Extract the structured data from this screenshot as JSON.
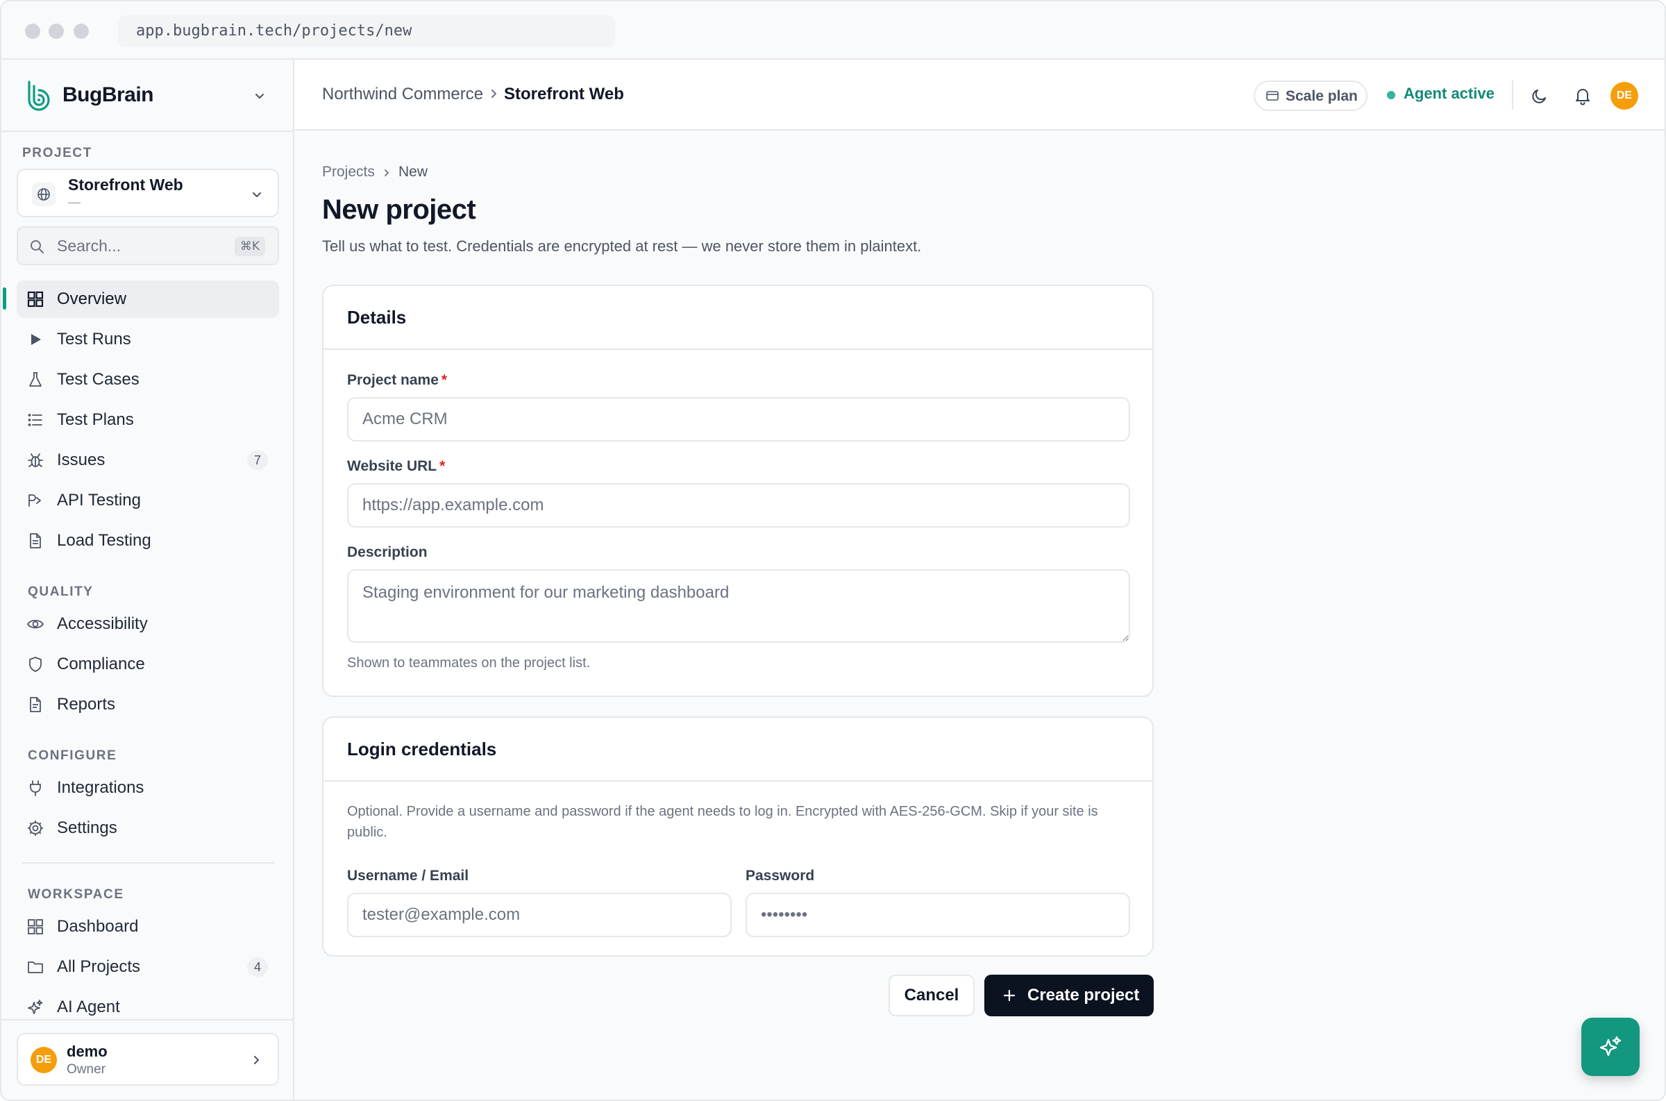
{
  "browser": {
    "url": "app.bugbrain.tech/projects/new"
  },
  "brand": {
    "name": "BugBrain"
  },
  "sidebar": {
    "project_section_label": "PROJECT",
    "project_selector": {
      "name": "Storefront Web",
      "subtitle": "—"
    },
    "search": {
      "placeholder": "Search...",
      "shortcut": "⌘K"
    },
    "main_items": [
      {
        "label": "Overview",
        "icon": "grid-icon",
        "active": true
      },
      {
        "label": "Test Runs",
        "icon": "play-icon"
      },
      {
        "label": "Test Cases",
        "icon": "flask-icon"
      },
      {
        "label": "Test Plans",
        "icon": "list-icon"
      },
      {
        "label": "Issues",
        "icon": "bug-icon",
        "badge": "7"
      },
      {
        "label": "API Testing",
        "icon": "api-icon"
      },
      {
        "label": "Load Testing",
        "icon": "file-icon"
      }
    ],
    "quality_label": "QUALITY",
    "quality_items": [
      {
        "label": "Accessibility",
        "icon": "eye-icon"
      },
      {
        "label": "Compliance",
        "icon": "shield-icon"
      },
      {
        "label": "Reports",
        "icon": "report-icon"
      }
    ],
    "configure_label": "CONFIGURE",
    "configure_items": [
      {
        "label": "Integrations",
        "icon": "plug-icon"
      },
      {
        "label": "Settings",
        "icon": "gear-icon"
      }
    ],
    "workspace_label": "WORKSPACE",
    "workspace_items": [
      {
        "label": "Dashboard",
        "icon": "grid-icon"
      },
      {
        "label": "All Projects",
        "icon": "folder-icon",
        "badge": "4"
      },
      {
        "label": "AI Agent",
        "icon": "sparkle-icon"
      }
    ],
    "user": {
      "initials": "DE",
      "name": "demo",
      "role": "Owner"
    }
  },
  "topbar": {
    "breadcrumb_org": "Northwind Commerce",
    "breadcrumb_project": "Storefront Web",
    "plan": "Scale plan",
    "agent_status": "Agent active",
    "avatar_initials": "DE"
  },
  "page": {
    "breadcrumb": [
      "Projects",
      "New"
    ],
    "title": "New project",
    "subtitle": "Tell us what to test. Credentials are encrypted at rest — we never store them in plaintext."
  },
  "details_card": {
    "title": "Details",
    "project_name_label": "Project name",
    "project_name_placeholder": "Acme CRM",
    "website_url_label": "Website URL",
    "website_url_placeholder": "https://app.example.com",
    "description_label": "Description",
    "description_placeholder": "Staging environment for our marketing dashboard",
    "description_helper": "Shown to teammates on the project list.",
    "required_mark": "*"
  },
  "login_card": {
    "title": "Login credentials",
    "helper": "Optional. Provide a username and password if the agent needs to log in. Encrypted with AES-256-GCM. Skip if your site is public.",
    "username_label": "Username / Email",
    "username_placeholder": "tester@example.com",
    "password_label": "Password",
    "password_placeholder": "••••••••"
  },
  "actions": {
    "cancel": "Cancel",
    "create": "Create project"
  },
  "colors": {
    "accent": "#0f9b84",
    "primary_button": "#0b1220",
    "avatar": "#f59e0b",
    "required": "#dc2626"
  }
}
